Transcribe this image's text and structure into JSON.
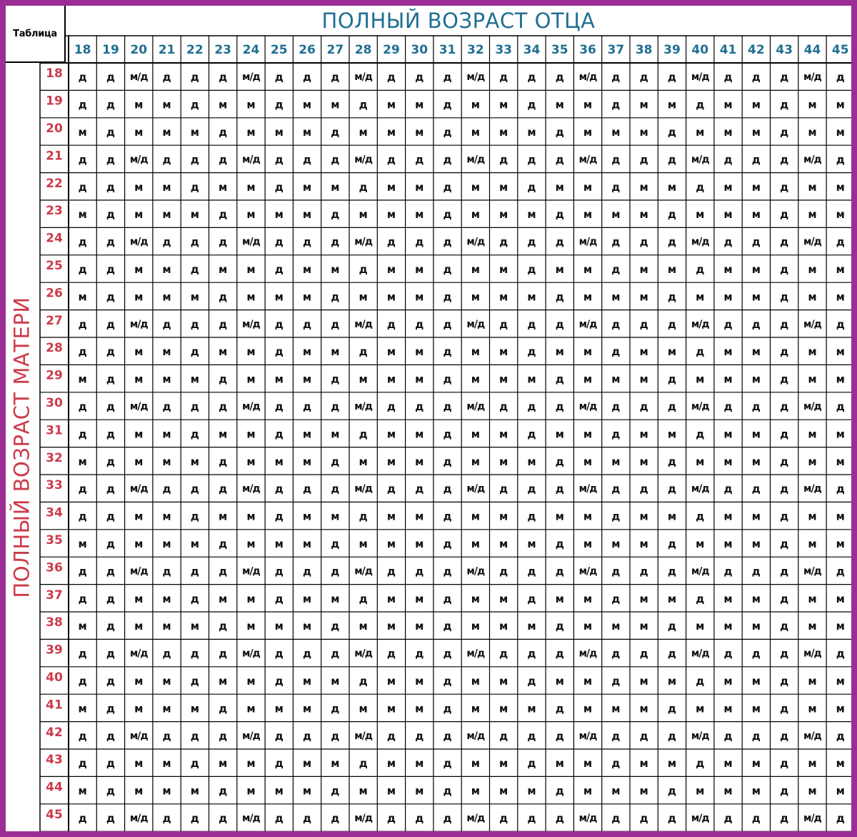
{
  "corner_label": "Таблица",
  "father_title": "ПОЛНЫЙ ВОЗРАСТ ОТЦА",
  "mother_title": "ПОЛНЫЙ ВОЗРАСТ МАТЕРИ",
  "father_ages": [
    "18",
    "19",
    "20",
    "21",
    "22",
    "23",
    "24",
    "25",
    "26",
    "27",
    "28",
    "29",
    "30",
    "31",
    "32",
    "33",
    "34",
    "35",
    "36",
    "37",
    "38",
    "39",
    "40",
    "41",
    "42",
    "43",
    "44",
    "45"
  ],
  "mother_ages": [
    "18",
    "19",
    "20",
    "21",
    "22",
    "23",
    "24",
    "25",
    "26",
    "27",
    "28",
    "29",
    "30",
    "31",
    "32",
    "33",
    "34",
    "35",
    "36",
    "37",
    "38",
    "39",
    "40",
    "41",
    "42",
    "43",
    "44",
    "45"
  ],
  "rows": [
    [
      "д",
      "д",
      "м/д",
      "д",
      "д",
      "д",
      "м/д",
      "д",
      "д",
      "д",
      "м/д",
      "д",
      "д",
      "д",
      "м/д",
      "д",
      "д",
      "д",
      "м/д",
      "д",
      "д",
      "д",
      "м/д",
      "д",
      "д",
      "д",
      "м/д",
      "д"
    ],
    [
      "д",
      "д",
      "м",
      "м",
      "д",
      "м",
      "м",
      "д",
      "м",
      "м",
      "д",
      "м",
      "м",
      "д",
      "м",
      "м",
      "д",
      "м",
      "м",
      "д",
      "м",
      "м",
      "д",
      "м",
      "м",
      "д",
      "м",
      "м"
    ],
    [
      "м",
      "д",
      "м",
      "м",
      "м",
      "д",
      "м",
      "м",
      "м",
      "д",
      "м",
      "м",
      "м",
      "д",
      "м",
      "м",
      "м",
      "д",
      "м",
      "м",
      "м",
      "д",
      "м",
      "м",
      "м",
      "д",
      "м",
      "м"
    ],
    [
      "д",
      "д",
      "м/д",
      "д",
      "д",
      "д",
      "м/д",
      "д",
      "д",
      "д",
      "м/д",
      "д",
      "д",
      "д",
      "м/д",
      "д",
      "д",
      "д",
      "м/д",
      "д",
      "д",
      "д",
      "м/д",
      "д",
      "д",
      "д",
      "м/д",
      "д"
    ],
    [
      "д",
      "д",
      "м",
      "м",
      "д",
      "м",
      "м",
      "д",
      "м",
      "м",
      "д",
      "м",
      "м",
      "д",
      "м",
      "м",
      "д",
      "м",
      "м",
      "д",
      "м",
      "м",
      "д",
      "м",
      "м",
      "д",
      "м",
      "м"
    ],
    [
      "м",
      "д",
      "м",
      "м",
      "м",
      "д",
      "м",
      "м",
      "м",
      "д",
      "м",
      "м",
      "м",
      "д",
      "м",
      "м",
      "м",
      "д",
      "м",
      "м",
      "м",
      "д",
      "м",
      "м",
      "м",
      "д",
      "м",
      "м"
    ],
    [
      "д",
      "д",
      "м/д",
      "д",
      "д",
      "д",
      "м/д",
      "д",
      "д",
      "д",
      "м/д",
      "д",
      "д",
      "д",
      "м/д",
      "д",
      "д",
      "д",
      "м/д",
      "д",
      "д",
      "д",
      "м/д",
      "д",
      "д",
      "д",
      "м/д",
      "д"
    ],
    [
      "д",
      "д",
      "м",
      "м",
      "д",
      "м",
      "м",
      "д",
      "м",
      "м",
      "д",
      "м",
      "м",
      "д",
      "м",
      "м",
      "д",
      "м",
      "м",
      "д",
      "м",
      "м",
      "д",
      "м",
      "м",
      "д",
      "м",
      "м"
    ],
    [
      "м",
      "д",
      "м",
      "м",
      "м",
      "д",
      "м",
      "м",
      "м",
      "д",
      "м",
      "м",
      "м",
      "д",
      "м",
      "м",
      "м",
      "д",
      "м",
      "м",
      "м",
      "д",
      "м",
      "м",
      "м",
      "д",
      "м",
      "м"
    ],
    [
      "д",
      "д",
      "м/д",
      "д",
      "д",
      "д",
      "м/д",
      "д",
      "д",
      "д",
      "м/д",
      "д",
      "д",
      "д",
      "м/д",
      "д",
      "д",
      "д",
      "м/д",
      "д",
      "д",
      "д",
      "м/д",
      "д",
      "д",
      "д",
      "м/д",
      "д"
    ],
    [
      "д",
      "д",
      "м",
      "м",
      "д",
      "м",
      "м",
      "д",
      "м",
      "м",
      "д",
      "м",
      "м",
      "д",
      "м",
      "м",
      "д",
      "м",
      "м",
      "д",
      "м",
      "м",
      "д",
      "м",
      "м",
      "д",
      "м",
      "м"
    ],
    [
      "м",
      "д",
      "м",
      "м",
      "м",
      "д",
      "м",
      "м",
      "м",
      "д",
      "м",
      "м",
      "м",
      "д",
      "м",
      "м",
      "м",
      "д",
      "м",
      "м",
      "м",
      "д",
      "м",
      "м",
      "м",
      "д",
      "м",
      "м"
    ],
    [
      "д",
      "д",
      "м/д",
      "д",
      "д",
      "д",
      "м/д",
      "д",
      "д",
      "д",
      "м/д",
      "д",
      "д",
      "д",
      "м/д",
      "д",
      "д",
      "д",
      "м/д",
      "д",
      "д",
      "д",
      "м/д",
      "д",
      "д",
      "д",
      "м/д",
      "д"
    ],
    [
      "д",
      "д",
      "м",
      "м",
      "д",
      "м",
      "м",
      "д",
      "м",
      "м",
      "д",
      "м",
      "м",
      "д",
      "м",
      "м",
      "д",
      "м",
      "м",
      "д",
      "м",
      "м",
      "д",
      "м",
      "м",
      "д",
      "м",
      "м"
    ],
    [
      "м",
      "д",
      "м",
      "м",
      "м",
      "д",
      "м",
      "м",
      "м",
      "д",
      "м",
      "м",
      "м",
      "д",
      "м",
      "м",
      "м",
      "д",
      "м",
      "м",
      "м",
      "д",
      "м",
      "м",
      "м",
      "д",
      "м",
      "м"
    ],
    [
      "д",
      "д",
      "м/д",
      "д",
      "д",
      "д",
      "м/д",
      "д",
      "д",
      "д",
      "м/д",
      "д",
      "д",
      "д",
      "м/д",
      "д",
      "д",
      "д",
      "м/д",
      "д",
      "д",
      "д",
      "м/д",
      "д",
      "д",
      "д",
      "м/д",
      "д"
    ],
    [
      "д",
      "д",
      "м",
      "м",
      "д",
      "м",
      "м",
      "д",
      "м",
      "м",
      "д",
      "м",
      "м",
      "д",
      "м",
      "м",
      "д",
      "м",
      "м",
      "д",
      "м",
      "м",
      "д",
      "м",
      "м",
      "д",
      "м",
      "м"
    ],
    [
      "м",
      "д",
      "м",
      "м",
      "м",
      "д",
      "м",
      "м",
      "м",
      "д",
      "м",
      "м",
      "м",
      "д",
      "м",
      "м",
      "м",
      "д",
      "м",
      "м",
      "м",
      "д",
      "м",
      "м",
      "м",
      "д",
      "м",
      "м"
    ],
    [
      "д",
      "д",
      "м/д",
      "д",
      "д",
      "д",
      "м/д",
      "д",
      "д",
      "д",
      "м/д",
      "д",
      "д",
      "д",
      "м/д",
      "д",
      "д",
      "д",
      "м/д",
      "д",
      "д",
      "д",
      "м/д",
      "д",
      "д",
      "д",
      "м/д",
      "д"
    ],
    [
      "д",
      "д",
      "м",
      "м",
      "д",
      "м",
      "м",
      "д",
      "м",
      "м",
      "д",
      "м",
      "м",
      "д",
      "м",
      "м",
      "д",
      "м",
      "м",
      "д",
      "м",
      "м",
      "д",
      "м",
      "м",
      "д",
      "м",
      "м"
    ],
    [
      "м",
      "д",
      "м",
      "м",
      "м",
      "д",
      "м",
      "м",
      "м",
      "д",
      "м",
      "м",
      "м",
      "д",
      "м",
      "м",
      "м",
      "д",
      "м",
      "м",
      "м",
      "д",
      "м",
      "м",
      "м",
      "д",
      "м",
      "м"
    ],
    [
      "д",
      "д",
      "м/д",
      "д",
      "д",
      "д",
      "м/д",
      "д",
      "д",
      "д",
      "м/д",
      "д",
      "д",
      "д",
      "м/д",
      "д",
      "д",
      "д",
      "м/д",
      "д",
      "д",
      "д",
      "м/д",
      "д",
      "д",
      "д",
      "м/д",
      "д"
    ],
    [
      "д",
      "д",
      "м",
      "м",
      "д",
      "м",
      "м",
      "д",
      "м",
      "м",
      "д",
      "м",
      "м",
      "д",
      "м",
      "м",
      "д",
      "м",
      "м",
      "д",
      "м",
      "м",
      "д",
      "м",
      "м",
      "д",
      "м",
      "м"
    ],
    [
      "м",
      "д",
      "м",
      "м",
      "м",
      "д",
      "м",
      "м",
      "м",
      "д",
      "м",
      "м",
      "м",
      "д",
      "м",
      "м",
      "м",
      "д",
      "м",
      "м",
      "м",
      "д",
      "м",
      "м",
      "м",
      "д",
      "м",
      "м"
    ],
    [
      "д",
      "д",
      "м/д",
      "д",
      "д",
      "д",
      "м/д",
      "д",
      "д",
      "д",
      "м/д",
      "д",
      "д",
      "д",
      "м/д",
      "д",
      "д",
      "д",
      "м/д",
      "д",
      "д",
      "д",
      "м/д",
      "д",
      "д",
      "д",
      "м/д",
      "д"
    ],
    [
      "д",
      "д",
      "м",
      "м",
      "д",
      "м",
      "м",
      "д",
      "м",
      "м",
      "д",
      "м",
      "м",
      "д",
      "м",
      "м",
      "д",
      "м",
      "м",
      "д",
      "м",
      "м",
      "д",
      "м",
      "м",
      "д",
      "м",
      "м"
    ],
    [
      "м",
      "д",
      "м",
      "м",
      "м",
      "д",
      "м",
      "м",
      "м",
      "д",
      "м",
      "м",
      "м",
      "д",
      "м",
      "м",
      "м",
      "д",
      "м",
      "м",
      "м",
      "д",
      "м",
      "м",
      "м",
      "д",
      "м",
      "м"
    ],
    [
      "д",
      "д",
      "м/д",
      "д",
      "д",
      "д",
      "м/д",
      "д",
      "д",
      "д",
      "м/д",
      "д",
      "д",
      "д",
      "м/д",
      "д",
      "д",
      "д",
      "м/д",
      "д",
      "д",
      "д",
      "м/д",
      "д",
      "д",
      "д",
      "м/д",
      "д"
    ]
  ]
}
